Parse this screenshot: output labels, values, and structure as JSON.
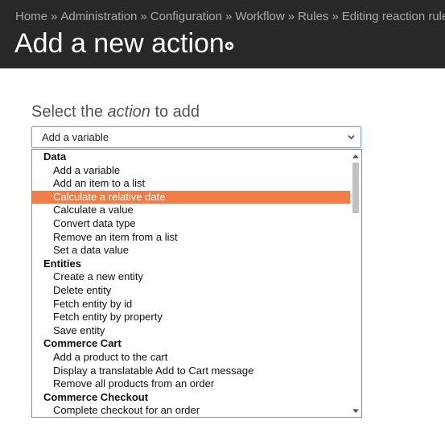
{
  "breadcrumb": {
    "items": [
      "Home",
      "Administration",
      "Configuration",
      "Workflow",
      "Rules",
      "Editing reaction rule \""
    ],
    "separator": "»"
  },
  "header": {
    "title": "Add a new action",
    "add_icon": "plus-circle-icon"
  },
  "form": {
    "label_prefix": "Select the ",
    "label_emphasis": "action",
    "label_suffix": " to add",
    "selected_value": "Add a variable"
  },
  "dropdown": {
    "groups": [
      {
        "label": "Data",
        "options": [
          "Add a variable",
          "Add an item to a list",
          "Calculate a relative date",
          "Calculate a value",
          "Convert data type",
          "Remove an item from a list",
          "Set a data value"
        ]
      },
      {
        "label": "Entities",
        "options": [
          "Create a new entity",
          "Delete entity",
          "Fetch entity by id",
          "Fetch entity by property",
          "Save entity"
        ]
      },
      {
        "label": "Commerce Cart",
        "options": [
          "Add a product to the cart",
          "Display a translatable Add to Cart message",
          "Remove all products from an order"
        ]
      },
      {
        "label": "Commerce Checkout",
        "options": [
          "Complete checkout for an order"
        ]
      }
    ],
    "highlighted": "Calculate a relative date"
  },
  "colors": {
    "header_bg": "#282828",
    "highlight": "#f07c47",
    "focus_border": "#7aa3d8"
  }
}
